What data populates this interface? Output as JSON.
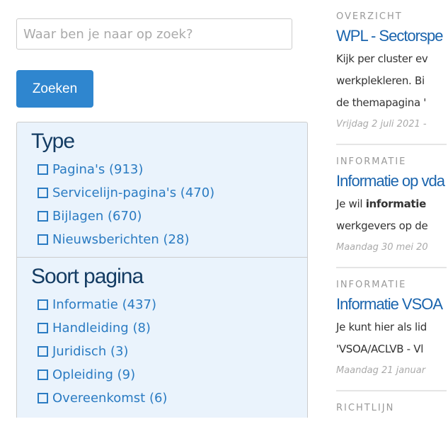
{
  "search": {
    "placeholder": "Waar ben je naar op zoek?",
    "button": "Zoeken"
  },
  "facets": [
    {
      "title": "Type",
      "options": [
        "Pagina's (913)",
        "Servicelijn-pagina's (470)",
        "Bijlagen (670)",
        "Nieuwsberichten (28)"
      ]
    },
    {
      "title": "Soort pagina",
      "options": [
        "Informatie (437)",
        "Handleiding (8)",
        "Juridisch (3)",
        "Opleiding (9)",
        "Overeenkomst (6)"
      ]
    }
  ],
  "results": [
    {
      "category": "OVERZICHT",
      "title": "WPL - Sectorspe",
      "lines": [
        "Kijk per cluster ev",
        "werkplekleren. Bi",
        "de themapagina '"
      ],
      "date": "Vrijdag 2 juli 2021 -"
    },
    {
      "category": "INFORMATIE",
      "title": "Informatie op vda",
      "lines_html": true,
      "line1_pre": "Je wil ",
      "line1_bold": "informatie",
      "lines": [
        "werkgevers op de"
      ],
      "date": "Maandag 30 mei 20"
    },
    {
      "category": "INFORMATIE",
      "title": "Informatie VSOA",
      "lines": [
        "Je kunt hier als lid",
        "'VSOA/ACLVB - Vl"
      ],
      "date": "Maandag 21 januar"
    },
    {
      "category": "RICHTLIJN",
      "title": "",
      "lines": [],
      "date": ""
    }
  ]
}
